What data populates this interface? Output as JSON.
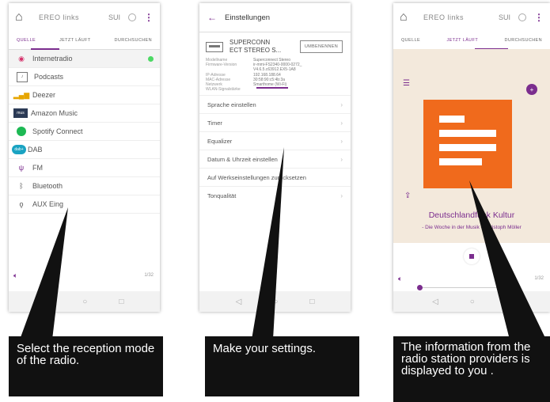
{
  "panel1": {
    "topbar": {
      "title": "EREO links",
      "code": "SUI"
    },
    "tabs": [
      "QUELLE",
      "JETZT LÄUFT",
      "DURCHSUCHEN"
    ],
    "sources": [
      {
        "label": "Internetradio",
        "icon": "internet-radio-icon"
      },
      {
        "label": "Podcasts",
        "icon": "podcasts-icon"
      },
      {
        "label": "Deezer",
        "icon": "deezer-icon"
      },
      {
        "label": "Amazon Music",
        "icon": "amazon-music-icon"
      },
      {
        "label": "Spotify Connect",
        "icon": "spotify-icon"
      },
      {
        "label": "DAB",
        "icon": "dab-icon"
      },
      {
        "label": "FM",
        "icon": "fm-icon"
      },
      {
        "label": "Bluetooth",
        "icon": "bluetooth-icon"
      },
      {
        "label": "AUX Eing",
        "icon": "aux-icon"
      }
    ],
    "page_indicator": "1/32"
  },
  "panel2": {
    "header": "Einstellungen",
    "device": {
      "name_line1": "SUPERCONN",
      "name_line2": "ECT STEREO S...",
      "rename": "UMBENENNEN"
    },
    "info": [
      {
        "k": "Modellname",
        "v": "Superconnect Stereo"
      },
      {
        "k": "Firmware-Version",
        "v": "ir-mmi-FS2340-0000-0272_"
      },
      {
        "k": "",
        "v": "V4.6.5.c63912.EX5-1A8"
      },
      {
        "k": "IP-Adresse",
        "v": "192.168.188.64"
      },
      {
        "k": "MAC-Adresse",
        "v": "30:58:90:c5:4b:3a"
      },
      {
        "k": "Netzwerk",
        "v": "Smarthome (Wi-Fi)"
      },
      {
        "k": "WLAN-Signalstärke",
        "v": ""
      }
    ],
    "settings": [
      {
        "label": "Sprache einstellen",
        "chevron": true
      },
      {
        "label": "Timer",
        "chevron": true
      },
      {
        "label": "Equalizer",
        "chevron": true
      },
      {
        "label": "Datum & Uhrzeit einstellen",
        "chevron": true
      },
      {
        "label": "Auf Werkseinstellungen zurücksetzen",
        "chevron": false
      },
      {
        "label": "Tonqualität",
        "chevron": true
      }
    ]
  },
  "panel3": {
    "topbar": {
      "title": "EREO links",
      "code": "SUI"
    },
    "tabs": [
      "QUELLE",
      "JETZT LÄUFT",
      "DURCHSUCHEN"
    ],
    "station": "Deutschlandfunk Kultur",
    "show": "- Die Woche in der Musik - Christoph Möller",
    "page_indicator": "1/32",
    "accent_color": "#7b2d8e",
    "logo_color": "#f06a1c"
  },
  "captions": {
    "c1": "Select the reception mode of the radio.",
    "c2": "Make your settings.",
    "c3": "The information from the radio station providers is displayed to you ."
  }
}
